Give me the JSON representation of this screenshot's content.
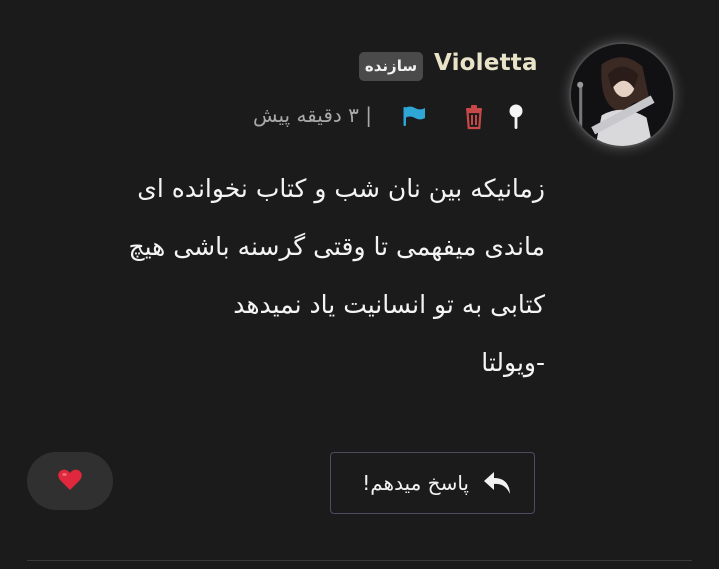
{
  "post": {
    "author": {
      "username": "Violetta",
      "badge": "سازنده",
      "avatar": "avatar-image"
    },
    "meta": {
      "time_text": "| ۳ دقیقه پیش",
      "icons": [
        "pin-icon",
        "trash-icon",
        "flag-icon"
      ]
    },
    "body_lines": [
      "زمانیکه بین نان شب و کتاب نخوانده ای",
      "ماندی میفهمی تا وقتی گرسنه باشی هیچ",
      "کتابی به تو انسانیت یاد نمیدهد",
      "-ویولتا"
    ],
    "actions": {
      "reply_label": "پاسخ میدهم!",
      "reply_icon": "reply-arrow-icon",
      "like_icon": "heart-icon"
    }
  },
  "colors": {
    "background": "#1b1b1b",
    "username": "#e9e3c9",
    "badge_bg": "#4a4a4a",
    "trash": "#c74848",
    "flag": "#2ea7d6",
    "heart": "#e0283c",
    "muted_text": "#a9a9a9"
  }
}
